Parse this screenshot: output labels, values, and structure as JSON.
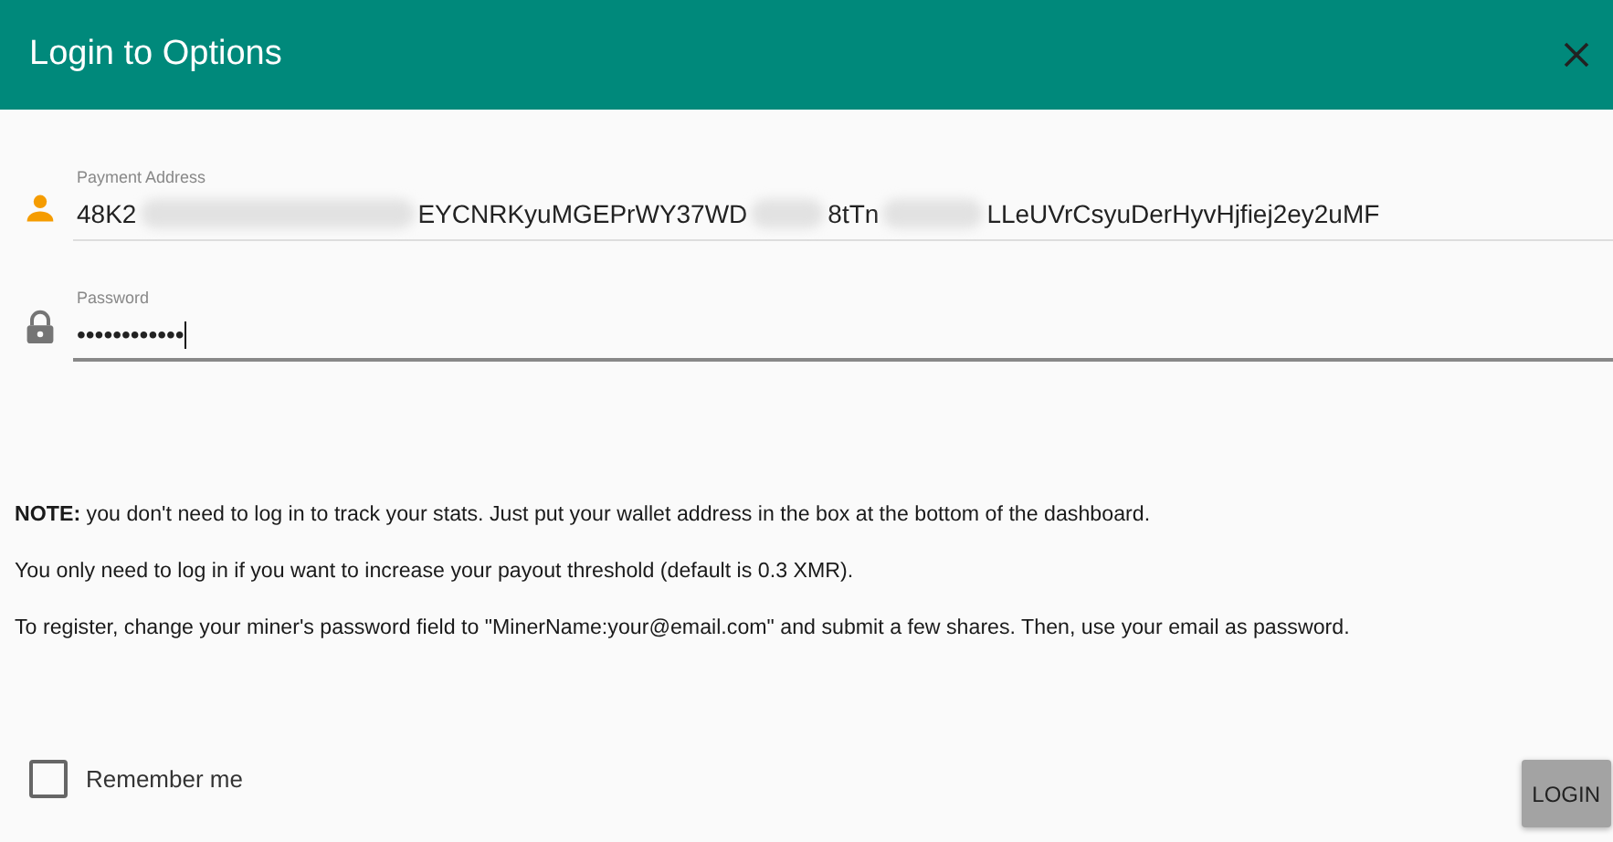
{
  "dialog": {
    "title": "Login to Options"
  },
  "fields": [
    {
      "kind": "address",
      "label": "Payment Address",
      "focused": false,
      "value_segments": [
        "48K2",
        "EYCNRKyuMGEPrWY37WD",
        "8tTn",
        "LLeUVrCsyuDerHyvHjfiej2ey2uMF"
      ]
    },
    {
      "kind": "password",
      "label": "Password",
      "focused": true,
      "value_segments": [
        "••••••••••••"
      ]
    }
  ],
  "notes": [
    "**NOTE:** you don't need to log in to track your stats. Just put your wallet address in the box at the bottom of the dashboard.",
    "You only need to log in if you want to increase your payout threshold (default is 0.3 XMR).",
    "To register, change your miner's password field to \"MinerName:your@email.com\" and submit a few shares. Then, use your email as password."
  ],
  "remember": {
    "label": "Remember me",
    "checked": false
  },
  "login_button": {
    "label": "LOGIN"
  }
}
